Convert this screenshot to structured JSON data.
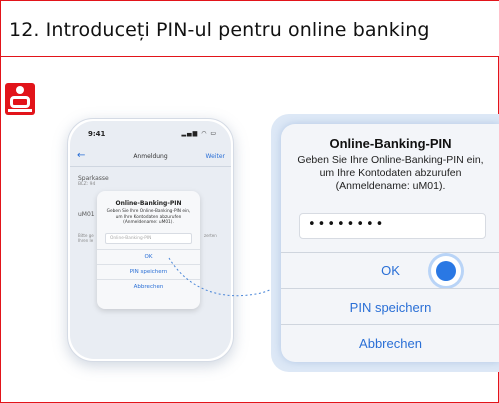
{
  "header": {
    "step_title": "12. Introduceți PIN-ul pentru online banking"
  },
  "logo": {
    "name": "sparkasse-logo-icon",
    "color": "#e2141a"
  },
  "phone": {
    "status_time": "9:41",
    "nav": {
      "back_icon": "←",
      "title": "Anmeldung",
      "next_label": "Weiter"
    },
    "bank_name": "Sparkasse",
    "bank_blz": "BLZ: 94",
    "login_short": "uM01",
    "hint_left": "Bitte ge Ihren Ie",
    "hint_right": "zerten",
    "dialog": {
      "title": "Online-Banking-PIN",
      "message": "Geben Sie Ihre Online-Banking-PIN ein, um Ihre Kontodaten abzurufen (Anmeldename: uM01).",
      "placeholder": "Online-Banking-PIN",
      "ok_label": "OK",
      "save_label": "PIN speichern",
      "cancel_label": "Abbrechen"
    }
  },
  "zoom": {
    "title": "Online-Banking-PIN",
    "message": "Geben Sie Ihre Online-Banking-PIN ein, um Ihre Kontodaten abzurufen (Anmeldename: uM01).",
    "pin_value": "••••••••",
    "ok_label": "OK",
    "save_label": "PIN speichern",
    "cancel_label": "Abbrechen"
  },
  "colors": {
    "accent": "#e2141a",
    "link": "#2a6fd6",
    "tap": "#2a78e4"
  }
}
